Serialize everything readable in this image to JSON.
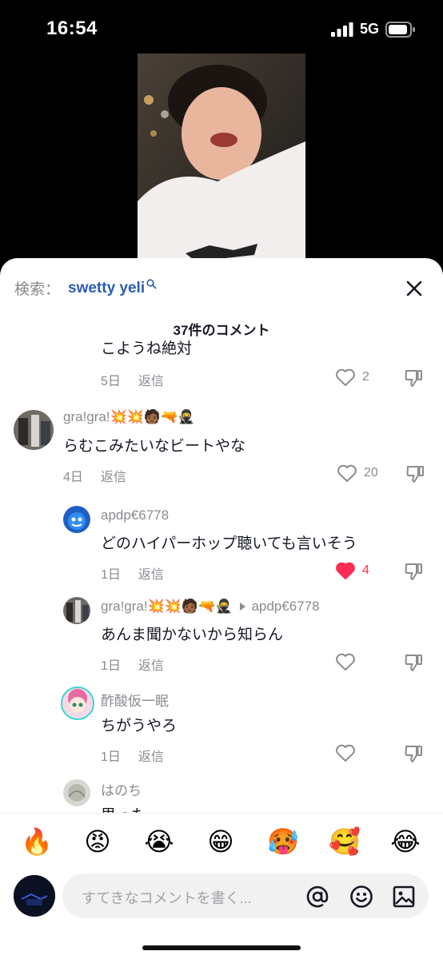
{
  "status_bar": {
    "time": "16:54",
    "network": "5G"
  },
  "search": {
    "prefix": "検索：",
    "term": "swetty yeli"
  },
  "comments_header": "37件のコメント",
  "comments": [
    {
      "text": "こようね絶対",
      "time": "5日",
      "reply_label": "返信",
      "likes": "2",
      "liked": false
    },
    {
      "user": "gra!gra!",
      "user_emoji": "💥💥🧑🏾🔫🥷",
      "text": "らむこみたいなビートやな",
      "time": "4日",
      "reply_label": "返信",
      "likes": "20",
      "liked": false
    },
    {
      "user": "apdp€6778",
      "text": "どのハイパーホップ聴いても言いそう",
      "time": "1日",
      "reply_label": "返信",
      "likes": "4",
      "liked": true
    },
    {
      "user": "gra!gra!",
      "user_emoji": "💥💥🧑🏾🔫🥷",
      "reply_to": "apdp€6778",
      "text": "あんま聞かないから知らん",
      "time": "1日",
      "reply_label": "返信",
      "likes": "",
      "liked": false
    },
    {
      "user": "酢酸仮一眠",
      "text": "ちがうやろ",
      "time": "1日",
      "reply_label": "返信",
      "likes": "",
      "liked": false
    },
    {
      "user": "はのち",
      "text": "思った",
      "time": "",
      "reply_label": "",
      "likes": "",
      "liked": false
    }
  ],
  "emoji_bar": [
    "🔥",
    "😡",
    "😭",
    "😁",
    "🥵",
    "🥰",
    "😂"
  ],
  "input": {
    "placeholder": "すてきなコメントを書く..."
  },
  "colors": {
    "link_blue": "#2a5db0",
    "like_red": "#fe2c55",
    "meta_gray": "#8a8b91"
  }
}
